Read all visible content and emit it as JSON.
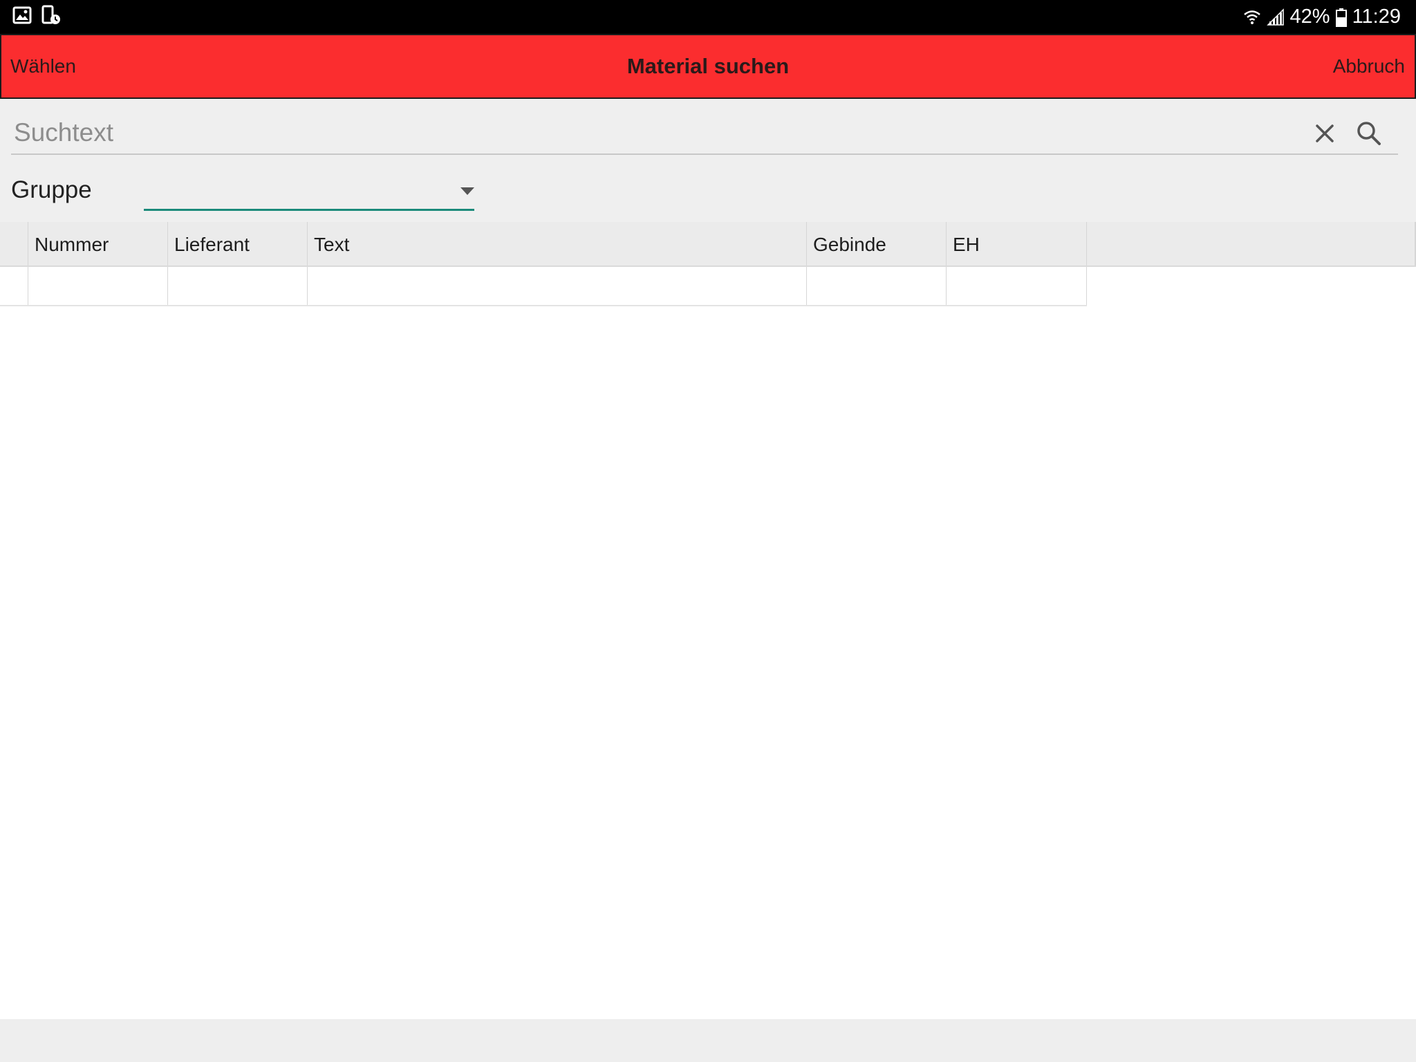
{
  "status_bar": {
    "battery_percent": "42%",
    "time": "11:29",
    "icons": [
      "gallery-icon",
      "screen-recorder-icon",
      "wifi-icon",
      "signal-icon",
      "battery-icon"
    ]
  },
  "header": {
    "left_action": "Wählen",
    "title": "Material suchen",
    "right_action": "Abbruch",
    "background_color": "#fb2d2f"
  },
  "search": {
    "placeholder": "Suchtext",
    "value": ""
  },
  "group": {
    "label": "Gruppe",
    "selected": ""
  },
  "table": {
    "columns": [
      "",
      "Nummer",
      "Lieferant",
      "Text",
      "Gebinde",
      "EH"
    ],
    "rows": [
      [
        "",
        "",
        "",
        "",
        "",
        ""
      ]
    ]
  },
  "accent_color": "#1a8a7a"
}
